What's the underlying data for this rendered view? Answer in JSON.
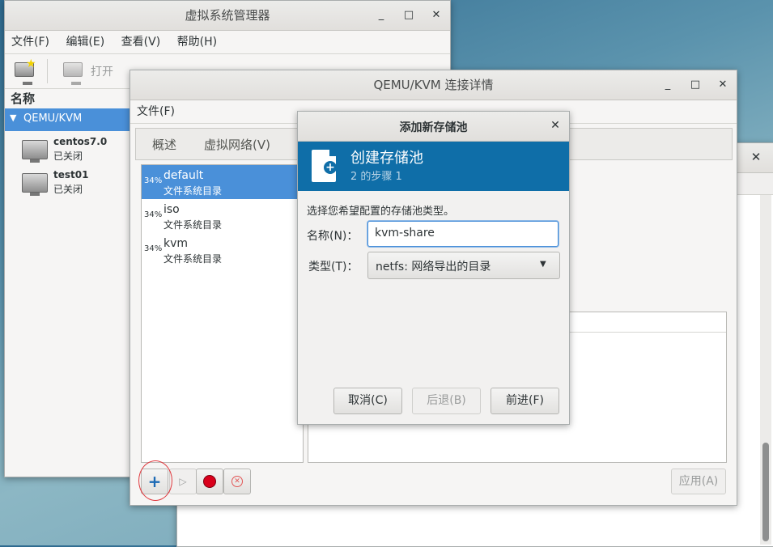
{
  "vmm": {
    "title": "虚拟系统管理器",
    "menu": [
      "文件(F)",
      "编辑(E)",
      "查看(V)",
      "帮助(H)"
    ],
    "toolbar_open": "打开",
    "column_header": "名称",
    "connection": "QEMU/KVM",
    "vms": [
      {
        "name": "centos7.0",
        "status": "已关闭"
      },
      {
        "name": "test01",
        "status": "已关闭"
      }
    ]
  },
  "details": {
    "title": "QEMU/KVM 连接详情",
    "menu_file": "文件(F)",
    "tabs": [
      "概述",
      "虚拟网络(V)"
    ],
    "pools": [
      {
        "pct": "34%",
        "name": "default",
        "type": "文件系统目录"
      },
      {
        "pct": "34%",
        "name": "iso",
        "type": "文件系统目录"
      },
      {
        "pct": "34%",
        "name": "kvm",
        "type": "文件系统目录"
      }
    ],
    "apply_label": "应用(A)"
  },
  "dialog": {
    "title": "添加新存储池",
    "header_title": "创建存储池",
    "header_step": "2 的步骤 1",
    "instruction": "选择您希望配置的存储池类型。",
    "name_label": "名称(N)：",
    "name_value": "kvm-share",
    "type_label": "类型(T)：",
    "type_value": "netfs: 网络导出的目录",
    "cancel_label": "取消(C)",
    "back_label": "后退(B)",
    "forward_label": "前进(F)"
  },
  "colors": {
    "selection": "#4a90d9",
    "dialog_header": "#0f6ea8",
    "highlight_circle": "#e0393e"
  }
}
